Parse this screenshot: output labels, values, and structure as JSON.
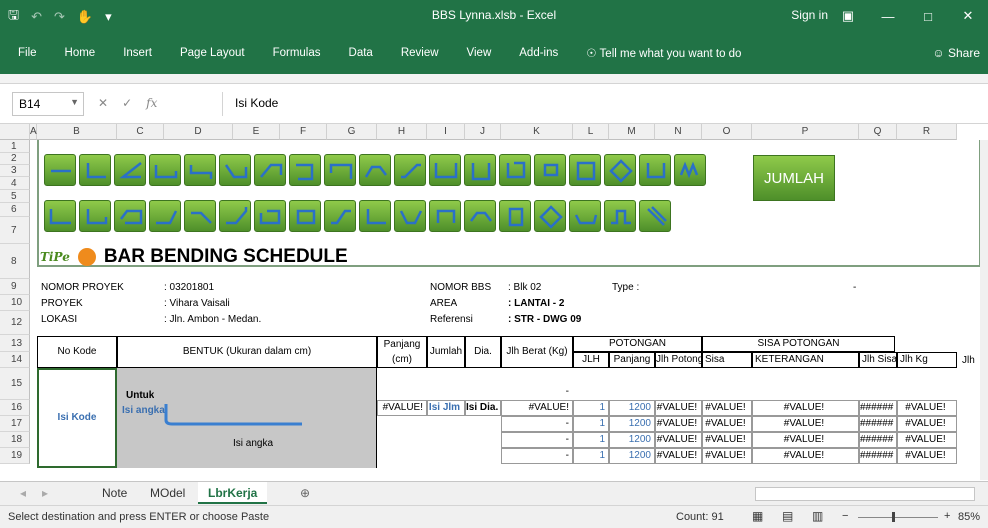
{
  "window": {
    "title": "BBS Lynna.xlsb - Excel",
    "sign_in": "Sign in",
    "share": "Share"
  },
  "ribbon_tabs": [
    "File",
    "Home",
    "Insert",
    "Page Layout",
    "Formulas",
    "Data",
    "Review",
    "View",
    "Add-ins"
  ],
  "tell_me": "Tell me what you want to do",
  "formula_bar": {
    "name_box": "B14",
    "content": "Isi Kode"
  },
  "columns": [
    "A",
    "B",
    "C",
    "D",
    "E",
    "F",
    "G",
    "H",
    "I",
    "J",
    "K",
    "L",
    "M",
    "N",
    "O",
    "P",
    "Q",
    "R"
  ],
  "rows": [
    "1",
    "2",
    "3",
    "4",
    "5",
    "6",
    "7",
    "8",
    "9",
    "10",
    "12",
    "13",
    "14",
    "15",
    "16",
    "17",
    "18",
    "19"
  ],
  "sheet": {
    "jumlah_button": "JUMLAH",
    "tipe": "TiPe",
    "title": "BAR BENDING SCHEDULE",
    "info": {
      "nomor_proyek_label": "NOMOR PROYEK",
      "nomor_proyek": ": 03201801",
      "proyek_label": "PROYEK",
      "proyek": ": Vihara Vaisali",
      "lokasi_label": "LOKASI",
      "lokasi": ": Jln. Ambon - Medan.",
      "nomor_bbs_label": "NOMOR BBS",
      "nomor_bbs": ": Blk 02",
      "area_label": "AREA",
      "area": ": LANTAI - 2",
      "referensi_label": "Referensi",
      "referensi": ": STR - DWG 09",
      "type_label": "Type :",
      "type_dash": "-"
    },
    "headers": {
      "no_kode": "No Kode",
      "bentuk": "BENTUK (Ukuran dalam cm)",
      "panjang": "Panjang",
      "cm": "(cm)",
      "jumlah": "Jumlah",
      "dia": "Dia.",
      "jlh_berat": "Jlh Berat (Kg)",
      "potongan": "POTONGAN",
      "jlh": "JLH",
      "panjang2": "Panjang",
      "jlh_potong": "Jlh Potong",
      "sisa_potongan": "SISA POTONGAN",
      "sisa": "Sisa",
      "keterangan": "KETERANGAN",
      "jlh_sisa": "Jlh Sisa",
      "jlh_kg": "Jlh Kg",
      "jlh_r": "Jlh"
    },
    "body": {
      "isi_kode": "Isi Kode",
      "untuk": "Untuk",
      "isi_angka": "Isi angka",
      "isi_angka2": "Isi angka",
      "value_err": "#VALUE!",
      "isi_jlm": "Isi Jlm",
      "isi_dia": "Isi Dia.",
      "dash": "-",
      "hashes": "######",
      "one": "1",
      "len": "1200"
    }
  },
  "sheet_tabs": [
    "Note",
    "MOdel",
    "LbrKerja"
  ],
  "status": {
    "message": "Select destination and press ENTER or choose Paste",
    "count": "Count: 91",
    "zoom": "85%"
  }
}
